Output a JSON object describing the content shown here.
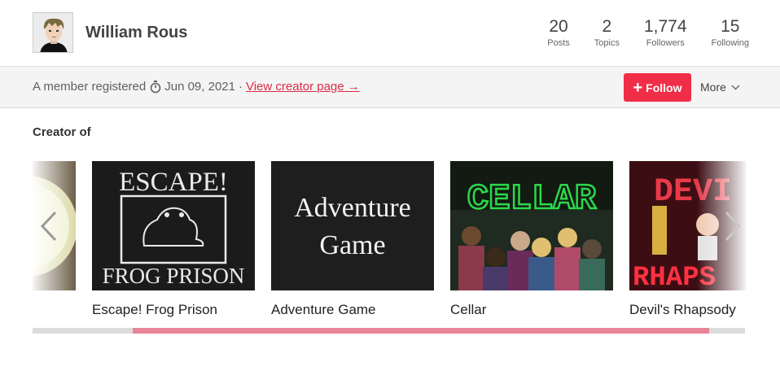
{
  "profile": {
    "username": "William Rous",
    "avatar_icon": "pixel-avatar-icon"
  },
  "stats": [
    {
      "value": "20",
      "label": "Posts"
    },
    {
      "value": "2",
      "label": "Topics"
    },
    {
      "value": "1,774",
      "label": "Followers"
    },
    {
      "value": "15",
      "label": "Following"
    }
  ],
  "info_bar": {
    "member_text": "A member registered",
    "date": "Jun 09, 2021",
    "separator": "·",
    "creator_link": "View creator page →",
    "follow_label": "Follow",
    "more_label": "More"
  },
  "creator_section": {
    "title": "Creator of",
    "games": [
      {
        "title": "Escape! Frog Prison",
        "art_text_top": "ESCAPE!",
        "art_text_bottom": "FROG PRISON"
      },
      {
        "title": "Adventure Game",
        "art_line1": "Adventure",
        "art_line2": "Game"
      },
      {
        "title": "Cellar",
        "art_text": "CELLAR"
      },
      {
        "title": "Devil's Rhapsody",
        "art_top": "DEVI",
        "art_bottom": "RHAPS"
      }
    ],
    "scroll_position": 0.14,
    "scroll_visible_fraction": 0.81
  },
  "colors": {
    "accent": "#f02e48",
    "link": "#da2c46",
    "scroll_thumb": "#e88497"
  }
}
